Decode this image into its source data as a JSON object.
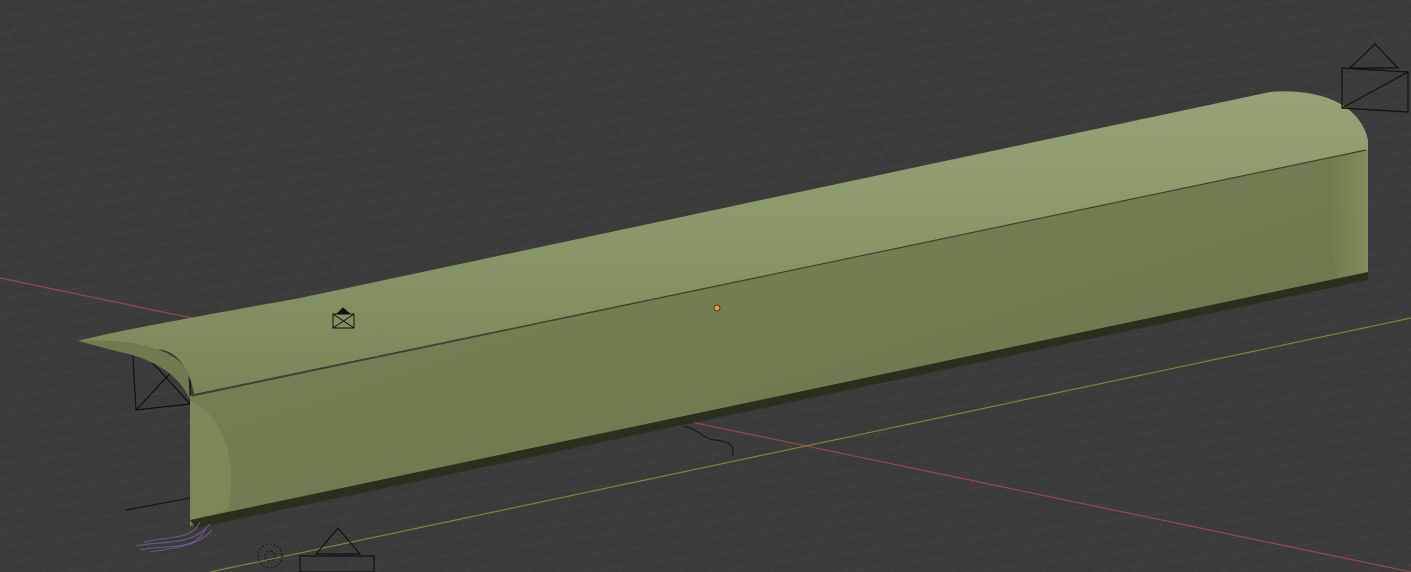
{
  "viewport": {
    "background": "#3b3b3b",
    "grid_color": "#4a4a4a",
    "axis_x_color": "#b5484e",
    "axis_y_color": "#7a9a3a"
  },
  "object": {
    "color": "#7e8a5e",
    "origin_color": "#f29a26"
  },
  "icons": {
    "camera": "camera-icon",
    "light": "sun-light-icon",
    "origin": "object-origin-icon",
    "curve": "curve-icon",
    "empty": "empty-icon"
  }
}
